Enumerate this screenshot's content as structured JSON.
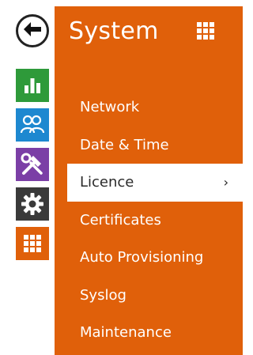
{
  "panel": {
    "title": "System",
    "accent": "#e0600a",
    "grid_icon": "apps-grid-icon"
  },
  "rail": {
    "back_icon": "back-arrow-icon",
    "tiles": [
      {
        "name": "status",
        "icon": "bar-chart-icon",
        "color": "#2e9a3a"
      },
      {
        "name": "directory",
        "icon": "users-icon",
        "color": "#1d88d0"
      },
      {
        "name": "hardware",
        "icon": "tools-icon",
        "color": "#7b3fa6"
      },
      {
        "name": "services",
        "icon": "gear-icon",
        "color": "#3a3a3a"
      },
      {
        "name": "system",
        "icon": "apps-grid-icon",
        "color": "#e0600a"
      }
    ]
  },
  "menu": {
    "items": [
      {
        "label": "Network"
      },
      {
        "label": "Date & Time"
      },
      {
        "label": "Licence",
        "active": true,
        "chevron": "›"
      },
      {
        "label": "Certificates"
      },
      {
        "label": "Auto Provisioning"
      },
      {
        "label": "Syslog"
      },
      {
        "label": "Maintenance"
      }
    ]
  }
}
